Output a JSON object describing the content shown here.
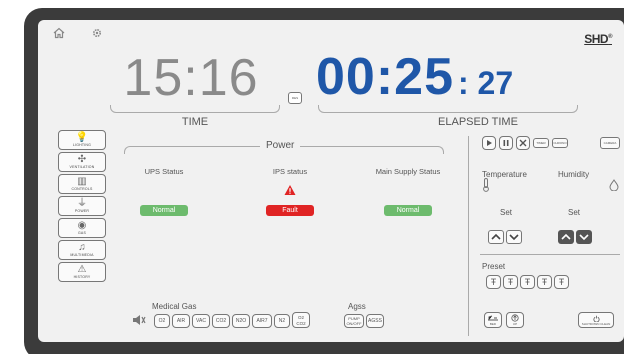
{
  "header": {
    "logo": "SHD",
    "logo_mark": "®",
    "icons": [
      "home-icon",
      "gear-icon"
    ]
  },
  "clock": {
    "time": "15:16",
    "time_label": "TIME",
    "reset_label": "RES",
    "elapsed_main": "00:25",
    "elapsed_sec": ": 27",
    "elapsed_label": "ELAPSED TIME"
  },
  "sidebar": {
    "items": [
      {
        "label": "LIGHTING",
        "icon": "lightbulb-icon"
      },
      {
        "label": "VENTILATION",
        "icon": "fan-icon"
      },
      {
        "label": "CONTROLS",
        "icon": "controls-icon"
      },
      {
        "label": "POWER",
        "icon": "plug-icon"
      },
      {
        "label": "GAS",
        "icon": "gas-icon"
      },
      {
        "label": "MULTIMEDIA",
        "icon": "music-icon"
      },
      {
        "label": "HISTORY",
        "icon": "history-icon"
      }
    ]
  },
  "power": {
    "title": "Power",
    "columns": [
      {
        "label": "UPS Status",
        "status": "Normal",
        "color": "#6dbb6d"
      },
      {
        "label": "IPS status",
        "status": "Fault",
        "color": "#e02424"
      },
      {
        "label": "Main Supply Status",
        "status": "Normal",
        "color": "#6dbb6d"
      }
    ]
  },
  "controls": {
    "media_buttons": [
      "play-icon",
      "pause-icon",
      "stop-icon"
    ],
    "text_buttons": [
      "TIMER",
      "CHRONO"
    ],
    "corner_button": "CAMERA"
  },
  "environment": {
    "temperature_label": "Temperature",
    "humidity_label": "Humidity",
    "set_label": "Set",
    "preset_label": "Preset",
    "preset_count": 5
  },
  "medical_gas": {
    "label": "Medical Gas",
    "buttons": [
      "O2",
      "AIR",
      "VAC",
      "CO2",
      "N2O",
      "AIR7",
      "N2",
      "O2 CO2"
    ]
  },
  "agss": {
    "label": "Agss",
    "buttons": [
      "PUMP ON/OFF",
      "AGSS"
    ]
  },
  "bottom_right": {
    "bed_button": "BED",
    "up_button": "UP",
    "power_button": "SHUTDOWN CLEAN"
  },
  "colors": {
    "elapsed": "#1f57a8",
    "normal": "#6dbb6d",
    "fault": "#e02424",
    "screen_bg": "#f1f1f1",
    "bezel": "#3b3b3b"
  }
}
